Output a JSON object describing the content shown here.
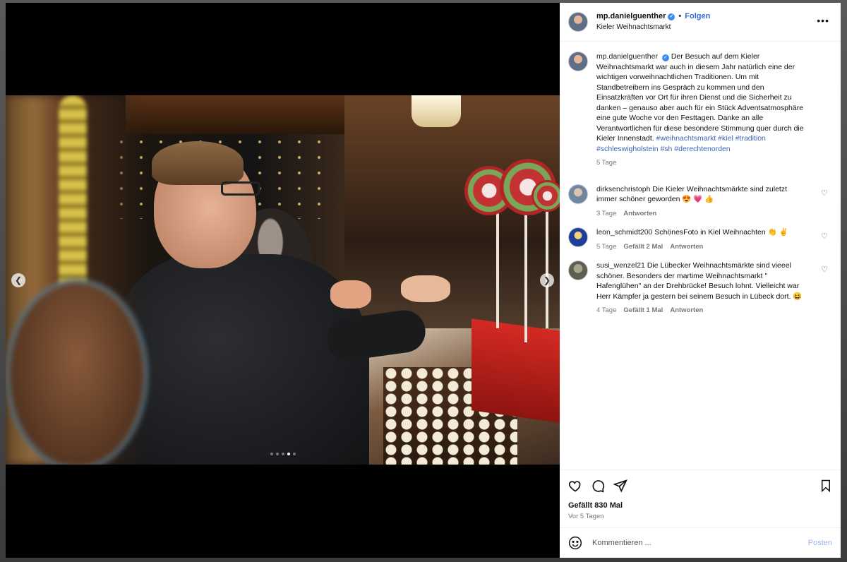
{
  "colors": {
    "accent": "#3569d6",
    "hashtag": "#3e65b0",
    "verified": "#3b8ced"
  },
  "post": {
    "username": "mp.danielguenther",
    "follow_label": "Folgen",
    "location": "Kieler Weihnachtsmarkt",
    "media": {
      "slides": 5,
      "active_slide": 4
    }
  },
  "caption": {
    "username": "mp.danielguenther",
    "text": "Der Besuch auf dem Kieler Weihnachtsmarkt war auch in diesem Jahr natürlich eine der wichtigen vorweihnachtlichen Traditionen. Um mit Standbetreibern ins Gespräch zu kommen und den Einsatzkräften vor Ort für ihren Dienst und die Sicherheit zu danken – genauso aber auch für ein Stück Adventsatmosphäre eine gute Woche vor den Festtagen. Danke an alle Verantwortlichen für diese besondere Stimmung quer durch die Kieler Innenstadt.",
    "hashtags": "#weihnachtsmarkt #kiel #tradition #schleswigholstein #sh #derechtenorden",
    "time": "5 Tage"
  },
  "comments": [
    {
      "username": "dirksenchristoph",
      "text": "Die Kieler Weihnachtsmärkte sind zuletzt immer schöner geworden 😍 💗 👍",
      "time": "3 Tage",
      "likes": "",
      "reply": "Antworten"
    },
    {
      "username": "leon_schmidt200",
      "text": "SchönesFoto in Kiel Weihnachten 👏 ✌️",
      "time": "5 Tage",
      "likes": "Gefällt 2 Mal",
      "reply": "Antworten"
    },
    {
      "username": "susi_wenzel21",
      "text": "Die Lübecker Weihnachtsmärkte sind vieeel schöner. Besonders der martime Weihnachtsmarkt \" Hafenglühen\" an der Drehbrücke! Besuch lohnt. Vielleicht war Herr Kämpfer ja gestern bei seinem Besuch in Lübeck dort. 😆",
      "time": "4 Tage",
      "likes": "Gefällt 1 Mal",
      "reply": "Antworten"
    }
  ],
  "footer": {
    "likes": "Gefällt 830 Mal",
    "posted": "Vor 5 Tagen",
    "comment_placeholder": "Kommentieren ...",
    "post_label": "Posten"
  },
  "icons": [
    "heart-icon",
    "comment-icon",
    "share-icon",
    "bookmark-icon",
    "emoji-icon",
    "more-icon",
    "verified-icon",
    "chevron-left-icon",
    "chevron-right-icon"
  ]
}
